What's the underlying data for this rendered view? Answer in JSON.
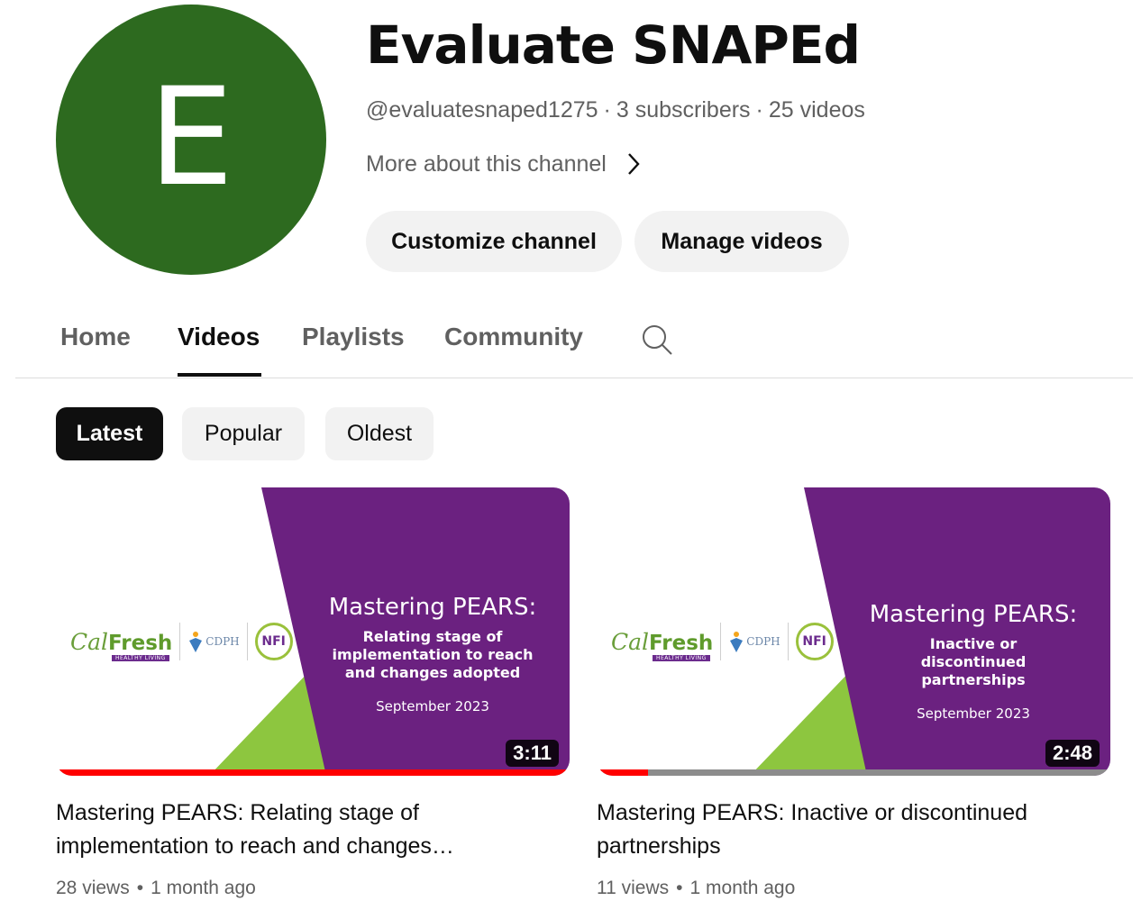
{
  "channel": {
    "avatar_letter": "E",
    "avatar_color": "#2d6a1f",
    "title": "Evaluate SNAPEd",
    "handle": "@evaluatesnaped1275",
    "subscribers": "3 subscribers",
    "videos_count": "25 videos",
    "separator": "·",
    "more_link": "More about this channel"
  },
  "buttons": {
    "customize": "Customize channel",
    "manage": "Manage videos"
  },
  "tabs": [
    {
      "label": "Home",
      "active": false
    },
    {
      "label": "Videos",
      "active": true
    },
    {
      "label": "Playlists",
      "active": false
    },
    {
      "label": "Community",
      "active": false
    }
  ],
  "chips": [
    {
      "label": "Latest",
      "active": true
    },
    {
      "label": "Popular",
      "active": false
    },
    {
      "label": "Oldest",
      "active": false
    }
  ],
  "colors": {
    "purple": "#6b2180",
    "green": "#8dc63f",
    "progress": "#ff0000"
  },
  "thumbnail_logos": {
    "calfresh_cal": "Cal",
    "calfresh_fresh": "Fresh",
    "calfresh_tag": "HEALTHY LIVING",
    "cdph": "CDPH",
    "nfi": "NFI"
  },
  "videos": [
    {
      "slide_title": "Mastering PEARS:",
      "slide_subtitle": "Relating stage of implementation to reach and changes adopted",
      "slide_date": "September 2023",
      "duration": "3:11",
      "watched_fraction": 1.0,
      "title": "Mastering PEARS: Relating stage of implementation to reach and changes…",
      "views": "28 views",
      "age": "1 month ago",
      "meta_separator": "•"
    },
    {
      "slide_title": "Mastering PEARS:",
      "slide_subtitle": "Inactive or discontinued partnerships",
      "slide_date": "September 2023",
      "duration": "2:48",
      "watched_fraction": 0.1,
      "title": "Mastering PEARS: Inactive or discontinued partnerships",
      "views": "11 views",
      "age": "1 month ago",
      "meta_separator": "•"
    }
  ]
}
